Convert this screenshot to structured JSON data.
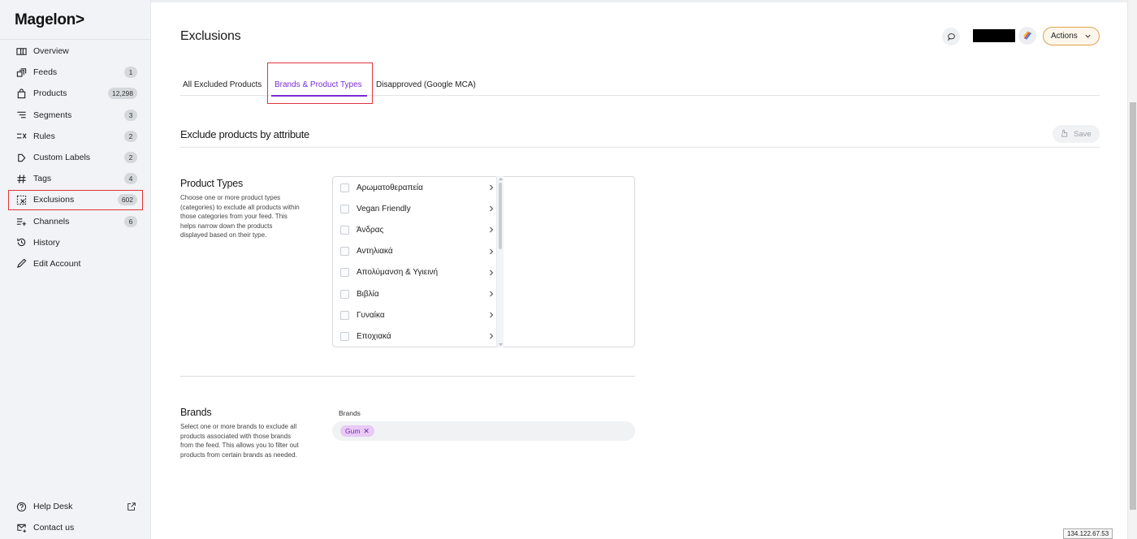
{
  "brand": {
    "logo": "Magelon>"
  },
  "sidebar": {
    "items": [
      {
        "label": "Overview",
        "icon": "overview-icon"
      },
      {
        "label": "Feeds",
        "count": "1",
        "icon": "feeds-icon"
      },
      {
        "label": "Products",
        "count": "12,298",
        "icon": "products-icon"
      },
      {
        "label": "Segments",
        "count": "3",
        "icon": "segments-icon"
      },
      {
        "label": "Rules",
        "count": "2",
        "icon": "rules-icon"
      },
      {
        "label": "Custom Labels",
        "count": "2",
        "icon": "custom-labels-icon"
      },
      {
        "label": "Tags",
        "count": "4",
        "icon": "tags-icon"
      },
      {
        "label": "Exclusions",
        "count": "602",
        "icon": "exclusions-icon",
        "active": true
      },
      {
        "label": "Channels",
        "count": "6",
        "icon": "channels-icon"
      },
      {
        "label": "History",
        "icon": "history-icon"
      },
      {
        "label": "Edit Account",
        "icon": "edit-icon"
      }
    ],
    "bottom": [
      {
        "label": "Help Desk",
        "icon": "help-icon"
      },
      {
        "label": "Contact us",
        "icon": "contact-icon"
      }
    ]
  },
  "header": {
    "title": "Exclusions",
    "actions_label": "Actions"
  },
  "tabs": [
    {
      "label": "All Excluded Products"
    },
    {
      "label": "Brands & Product Types",
      "active": true
    },
    {
      "label": "Disapproved (Google MCA)"
    }
  ],
  "section": {
    "title": "Exclude products by attribute",
    "save_label": "Save"
  },
  "product_types": {
    "title": "Product Types",
    "description": "Choose one or more product types (categories) to exclude all products within those categories from your feed. This helps narrow down the products displayed based on their type.",
    "items": [
      "Αρωματοθεραπεία",
      "Vegan Friendly",
      "Άνδρας",
      "Αντηλιακά",
      "Απολύμανση & Υγιεινή",
      "Βιβλία",
      "Γυναίκα",
      "Εποχιακά"
    ]
  },
  "brands": {
    "title": "Brands",
    "description": "Select one or more brands to exclude all products associated with those brands from the feed. This allows you to filter out products from certain brands as needed.",
    "field_label": "Brands",
    "selected": [
      "Gum"
    ]
  },
  "footer": {
    "ip": "134.122.67.53"
  },
  "colors": {
    "accent": "#7b2bd6",
    "highlight": "#e2333b",
    "actions_border": "#e0a24d",
    "chip_bg": "#e8c9f7"
  }
}
